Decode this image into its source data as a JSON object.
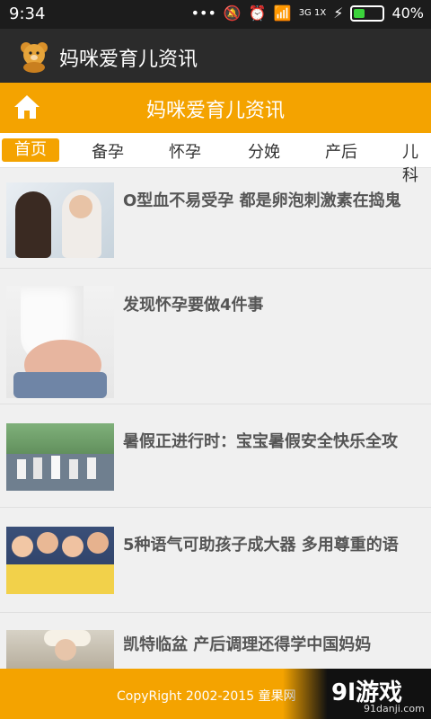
{
  "status": {
    "time": "9:34",
    "network": "3G 1X",
    "battery_percent": "40%"
  },
  "app": {
    "title": "妈咪爱育儿资讯"
  },
  "header": {
    "title": "妈咪爱育儿资讯"
  },
  "tabs": [
    "首页",
    "备孕",
    "怀孕",
    "分娩",
    "产后",
    "儿科"
  ],
  "articles": [
    {
      "title": "O型血不易受孕 都是卵泡刺激素在捣鬼"
    },
    {
      "title": "发现怀孕要做4件事"
    },
    {
      "title": "暑假正进行时：宝宝暑假安全快乐全攻"
    },
    {
      "title": "5种语气可助孩子成大器 多用尊重的语"
    },
    {
      "title": "凯特临盆 产后调理还得学中国妈妈"
    }
  ],
  "footer": {
    "copyright": "CopyRight 2002-2015 童果网",
    "watermark_main": "9l游戏",
    "watermark_sub": "91danji.com"
  },
  "colors": {
    "accent": "#f4a300",
    "dark": "#2b2b2b"
  }
}
